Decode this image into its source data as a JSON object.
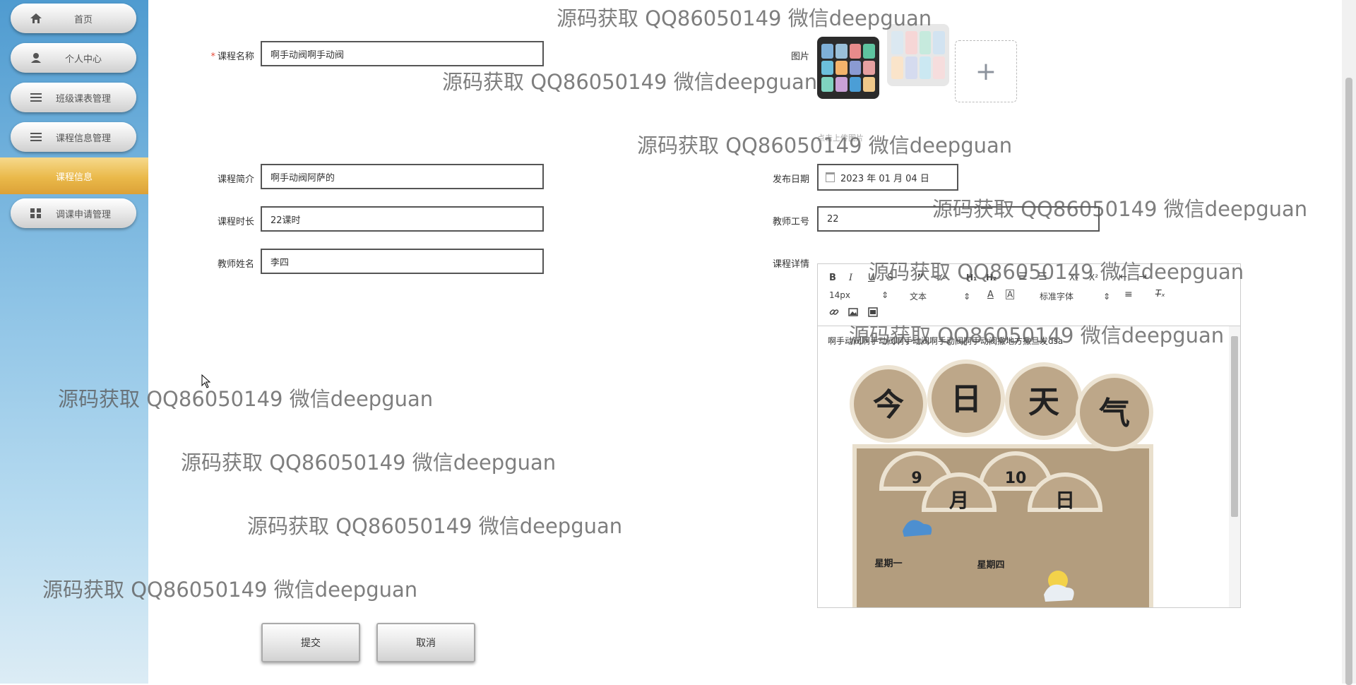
{
  "sidebar": {
    "items": [
      {
        "label": "首页",
        "icon": "home-icon"
      },
      {
        "label": "个人中心",
        "icon": "user-icon"
      },
      {
        "label": "班级课表管理",
        "icon": "menu-icon"
      },
      {
        "label": "课程信息管理",
        "icon": "menu-icon"
      },
      {
        "label": "调课申请管理",
        "icon": "grid-icon"
      }
    ],
    "active_label": "课程信息"
  },
  "form": {
    "course_name": {
      "label": "课程名称",
      "required_mark": "*",
      "value": "啊手动阀啊手动阀"
    },
    "image": {
      "label": "图片",
      "caption": "点击上传图片"
    },
    "course_intro": {
      "label": "课程简介",
      "value": "啊手动阀阿萨的"
    },
    "publish_date": {
      "label": "发布日期",
      "value": "2023 年 01 月 04 日"
    },
    "course_duration": {
      "label": "课程时长",
      "value": "22课时"
    },
    "teacher_id": {
      "label": "教师工号",
      "value": "22"
    },
    "teacher_name": {
      "label": "教师姓名",
      "value": "李四"
    },
    "course_detail": {
      "label": "课程详情",
      "font_size": "14px",
      "text_style": "文本",
      "font_family": "标准字体",
      "content_text": "啊手动阀啊手动阀啊手动阀啊手动阀啊手动阀撒地方撒旦发dsa"
    }
  },
  "photo_text": [
    "今",
    "日",
    "天",
    "气",
    "9",
    "10",
    "月",
    "日",
    "星期一",
    "星期四"
  ],
  "actions": {
    "submit": "提交",
    "cancel": "取消"
  },
  "watermark": "源码获取 QQ86050149 微信deepguan",
  "colors": {
    "active_nav": "#eab94a",
    "sidebar_top": "#4f9bd0",
    "required": "#e74c3c"
  }
}
